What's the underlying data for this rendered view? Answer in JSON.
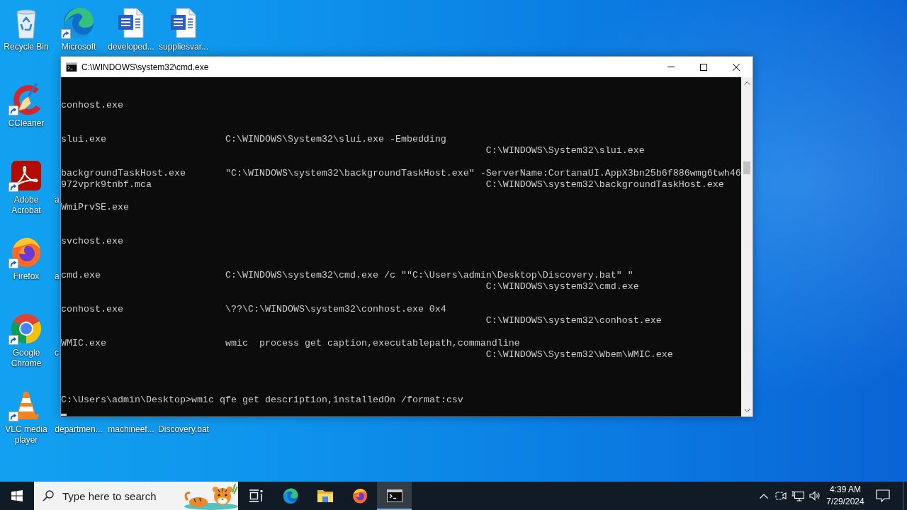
{
  "desktop": {
    "icon_rows": [
      [
        {
          "label": "Recycle Bin",
          "kind": "recycle-bin",
          "shortcut": false
        },
        {
          "label": "Microsoft",
          "kind": "edge",
          "shortcut": true
        },
        {
          "label": "developed...",
          "kind": "word-document",
          "shortcut": false
        },
        {
          "label": "suppliesvar...",
          "kind": "word-document",
          "shortcut": false
        }
      ],
      [
        {
          "label": "CCleaner",
          "kind": "ccleaner",
          "shortcut": true
        }
      ],
      [
        {
          "label": "Adobe Acrobat",
          "kind": "acrobat",
          "shortcut": true
        },
        {
          "label": "a",
          "kind": "clipped"
        }
      ],
      [
        {
          "label": "Firefox",
          "kind": "firefox",
          "shortcut": true
        },
        {
          "label": "a",
          "kind": "clipped"
        }
      ],
      [
        {
          "label": "Google Chrome",
          "kind": "chrome",
          "shortcut": true
        },
        {
          "label": "c",
          "kind": "clipped"
        }
      ],
      [
        {
          "label": "VLC media player",
          "kind": "vlc",
          "shortcut": true
        },
        {
          "label": "departmen...",
          "kind": "covered"
        },
        {
          "label": "machineef...",
          "kind": "covered"
        },
        {
          "label": "Discovery.bat",
          "kind": "covered"
        }
      ]
    ]
  },
  "window": {
    "title": "C:\\WINDOWS\\system32\\cmd.exe",
    "console": {
      "entries": [
        {
          "caption": "conhost.exe"
        },
        {
          "caption": "slui.exe",
          "command_line": [
            "C:\\WINDOWS\\System32\\slui.exe -Embedding"
          ],
          "executable_path": "C:\\WINDOWS\\System32\\slui.exe"
        },
        {
          "caption": "backgroundTaskHost.exe",
          "command_line": [
            "\"C:\\WINDOWS\\system32\\backgroundTaskHost.exe\" -ServerName:CortanaUI.AppX3bn25b6f886wmg6twh46",
            "972vprk9tnbf.mca"
          ],
          "executable_path": "C:\\WINDOWS\\system32\\backgroundTaskHost.exe"
        },
        {
          "caption": "WmiPrvSE.exe"
        },
        {
          "caption": "svchost.exe"
        },
        {
          "caption": "cmd.exe",
          "command_line": [
            "C:\\WINDOWS\\system32\\cmd.exe /c \"\"C:\\Users\\admin\\Desktop\\Discovery.bat\" \""
          ],
          "executable_path": "C:\\WINDOWS\\system32\\cmd.exe"
        },
        {
          "caption": "conhost.exe",
          "command_line": [
            "\\??\\C:\\WINDOWS\\system32\\conhost.exe 0x4"
          ],
          "executable_path": "C:\\WINDOWS\\system32\\conhost.exe"
        },
        {
          "caption": "WMIC.exe",
          "command_line": [
            "wmic  process get caption,executablepath,commandline"
          ],
          "executable_path": "C:\\WINDOWS\\System32\\Wbem\\WMIC.exe"
        }
      ],
      "prompt": "C:\\Users\\admin\\Desktop>wmic qfe get description,installedOn /format:csv"
    }
  },
  "taskbar": {
    "search": {
      "placeholder": "Type here to search"
    },
    "buttons": [
      {
        "kind": "task-view",
        "selected": false
      },
      {
        "kind": "edge",
        "selected": false
      },
      {
        "kind": "file-explorer",
        "selected": false
      },
      {
        "kind": "firefox",
        "selected": false
      },
      {
        "kind": "console",
        "selected": true
      }
    ],
    "clock": {
      "time": "4:39 AM",
      "date": "7/29/2024"
    }
  }
}
